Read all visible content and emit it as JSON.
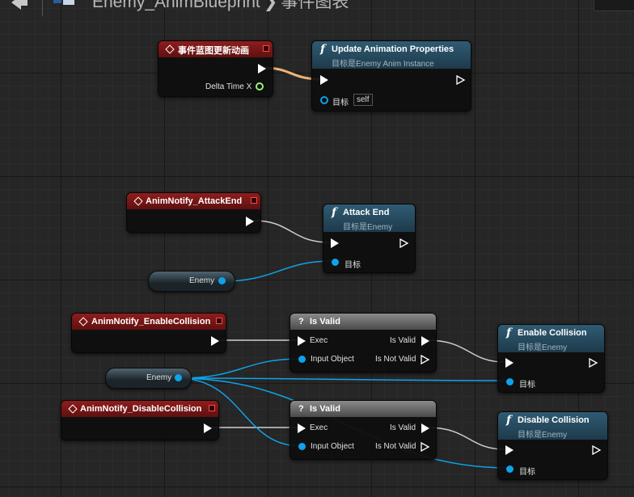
{
  "breadcrumb": {
    "asset_name": "Enemy_AnimBlueprint",
    "separator": "❯",
    "graph_name": "事件图表"
  },
  "events": {
    "blueprint_update": {
      "title": "事件蓝图更新动画",
      "delta_time_label": "Delta Time X"
    },
    "attack_end": {
      "title": "AnimNotify_AttackEnd"
    },
    "enable_collision": {
      "title": "AnimNotify_EnableCollision"
    },
    "disable_collision": {
      "title": "AnimNotify_DisableCollision"
    }
  },
  "functions": {
    "update_anim_props": {
      "title": "Update Animation Properties",
      "subtitle": "目标是Enemy Anim Instance",
      "target_label": "目标",
      "self_label": "self"
    },
    "attack_end": {
      "title": "Attack End",
      "subtitle": "目标是Enemy",
      "target_label": "目标"
    },
    "enable_collision": {
      "title": "Enable Collision",
      "subtitle": "目标是Enemy",
      "target_label": "目标"
    },
    "disable_collision": {
      "title": "Disable Collision",
      "subtitle": "目标是Enemy",
      "target_label": "目标"
    }
  },
  "macros": {
    "is_valid_1": {
      "title": "Is Valid",
      "exec_label": "Exec",
      "input_label": "Input Object",
      "valid_label": "Is Valid",
      "not_valid_label": "Is Not Valid"
    },
    "is_valid_2": {
      "title": "Is Valid",
      "exec_label": "Exec",
      "input_label": "Input Object",
      "valid_label": "Is Valid",
      "not_valid_label": "Is Not Valid"
    }
  },
  "variables": {
    "enemy_1": {
      "label": "Enemy"
    },
    "enemy_2": {
      "label": "Enemy"
    }
  },
  "colors": {
    "event_header": "#8f1d1d",
    "function_header": "#2f5b73",
    "macro_header": "#6a6a6a",
    "object_pin": "#0fa2ea",
    "float_pin": "#9bf07a",
    "exec_wire": "#ffffff",
    "float_wire": "#f0a070"
  },
  "icons": {
    "event": "event-diamond-icon",
    "function": "function-f-icon",
    "macro": "question-mark-icon",
    "graph_tab": "blueprint-graph-icon"
  }
}
